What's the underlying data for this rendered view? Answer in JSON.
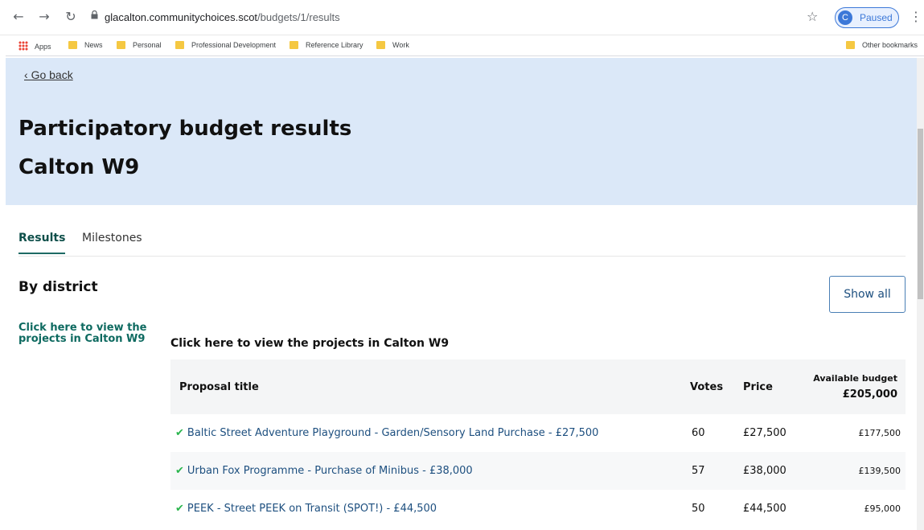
{
  "browser": {
    "url_host": "glacalton.communitychoices.scot",
    "url_path": "/budgets/1/results",
    "profile_initial": "C",
    "profile_label": "Paused",
    "bookmarks": [
      "Apps",
      "News",
      "Personal",
      "Professional Development",
      "Reference Library",
      "Work"
    ],
    "other_bookmarks": "Other bookmarks"
  },
  "page": {
    "go_back": "Go back",
    "title_line1": "Participatory budget results",
    "title_line2": "Calton W9",
    "tabs": [
      "Results",
      "Milestones"
    ],
    "district_heading": "By district",
    "show_all": "Show all",
    "side_link": "Click here to view the projects in Calton W9",
    "table_title": "Click here to view the projects in Calton W9"
  },
  "table": {
    "headers": {
      "title": "Proposal title",
      "votes": "Votes",
      "price": "Price",
      "budget_label": "Available budget",
      "budget_total": "£205,000"
    },
    "rows": [
      {
        "title": "Baltic Street Adventure Playground - Garden/Sensory Land Purchase - £27,500",
        "votes": "60",
        "price": "£27,500",
        "budget": "£177,500"
      },
      {
        "title": "Urban Fox Programme - Purchase of Minibus - £38,000",
        "votes": "57",
        "price": "£38,000",
        "budget": "£139,500"
      },
      {
        "title": "PEEK - Street PEEK on Transit (SPOT!) - £44,500",
        "votes": "50",
        "price": "£44,500",
        "budget": "£95,000"
      }
    ]
  },
  "colors": {
    "hero_bg": "#dbe8f8",
    "accent_green": "#0e6a60",
    "link_blue": "#1d4f7f",
    "check_green": "#2ab54d"
  }
}
